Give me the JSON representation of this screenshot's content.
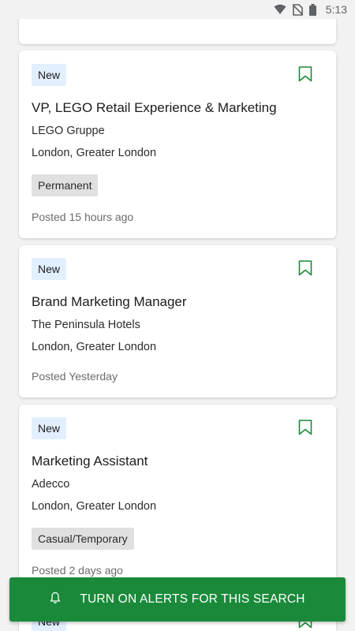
{
  "status_bar": {
    "time": "5:13",
    "icons": [
      "wifi-icon",
      "no-sim-icon",
      "battery-icon"
    ]
  },
  "jobs": [
    {
      "badge": "New",
      "title": "VP, LEGO Retail Experience & Marketing",
      "company": "LEGO Gruppe",
      "location": "London, Greater London",
      "tag": "Permanent",
      "posted": "Posted 15 hours ago"
    },
    {
      "badge": "New",
      "title": "Brand Marketing Manager",
      "company": "The Peninsula Hotels",
      "location": "London, Greater London",
      "tag": "",
      "posted": "Posted Yesterday"
    },
    {
      "badge": "New",
      "title": "Marketing Assistant",
      "company": "Adecco",
      "location": "London, Greater London",
      "tag": "Casual/Temporary",
      "posted": "Posted 2 days ago"
    },
    {
      "badge": "New"
    }
  ],
  "alert_bar": {
    "label": "TURN ON ALERTS FOR THIS SEARCH",
    "icon": "bell-icon"
  },
  "colors": {
    "accent_green": "#1a8a3a",
    "badge_bg": "#e1efff",
    "tag_bg": "#e0e0e0"
  }
}
